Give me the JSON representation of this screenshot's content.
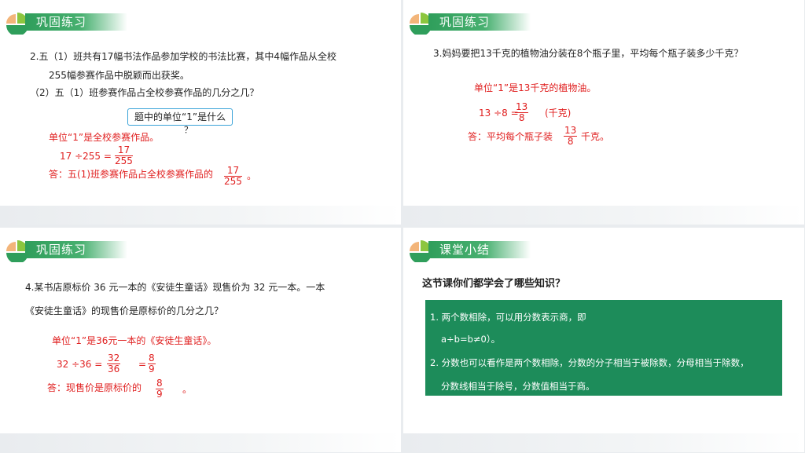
{
  "slide1": {
    "header": "巩固练习",
    "q_line1": "2.五（1）班共有17幅书法作品参加学校的书法比赛，其中4幅作品从全校",
    "q_line2": "255幅参赛作品中脱颖而出获奖。",
    "q_line3": "（2）五（1）班参赛作品占全校参赛作品的几分之几？",
    "hint": "题中的单位“1”是什么",
    "hint_q": "？",
    "unit_line": "单位“1”是全校参赛作品。",
    "eq_prefix": "17 ÷255 =",
    "eq_num": "17",
    "eq_den": "255",
    "ans_prefix": "答：五(1)班参赛作品占全校参赛作品的",
    "ans_num": "17",
    "ans_den": "255",
    "ans_suffix": "。"
  },
  "slide2": {
    "header": "巩固练习",
    "q_line1": "3.妈妈要把13千克的植物油分装在8个瓶子里，平均每个瓶子装多少千克？",
    "unit_line": "单位“1”是13千克的植物油。",
    "eq_prefix": "13 ÷8 =",
    "eq_num": "13",
    "eq_den": "8",
    "eq_unit": "(千克)",
    "ans_prefix": "答：平均每个瓶子装",
    "ans_num": "13",
    "ans_den": "8",
    "ans_suffix": "千克。"
  },
  "slide3": {
    "header": "巩固练习",
    "q_line1": "4.某书店原标价 36 元一本的《安徒生童话》现售价为 32 元一本。一本",
    "q_line2": "《安徒生童话》的现售价是原标价的几分之几？",
    "unit_line": "单位“1”是36元一本的《安徒生童话》。",
    "eq_prefix": "32 ÷36 =",
    "eq_num1": "32",
    "eq_den1": "36",
    "eq_eq2": "=",
    "eq_num2": "8",
    "eq_den2": "9",
    "ans_prefix": "答：现售价是原标价的",
    "ans_num": "8",
    "ans_den": "9",
    "ans_suffix": "。"
  },
  "slide4": {
    "header": "课堂小结",
    "question": "这节课你们都学会了哪些知识？",
    "p1a": "1. 两个数相除，可以用分数表示商，即",
    "p1b": "a÷b=b≠0）。",
    "p2a": "2. 分数也可以看作是两个数相除，分数的分子相当于被除数，分母相当于除数，",
    "p2b": "分数线相当于除号，分数值相当于商。"
  },
  "colors": {
    "green": "#2f9e5b",
    "red": "#e02020",
    "summary_bg": "#1d8c5a",
    "hint_border": "#3aa3d8"
  }
}
